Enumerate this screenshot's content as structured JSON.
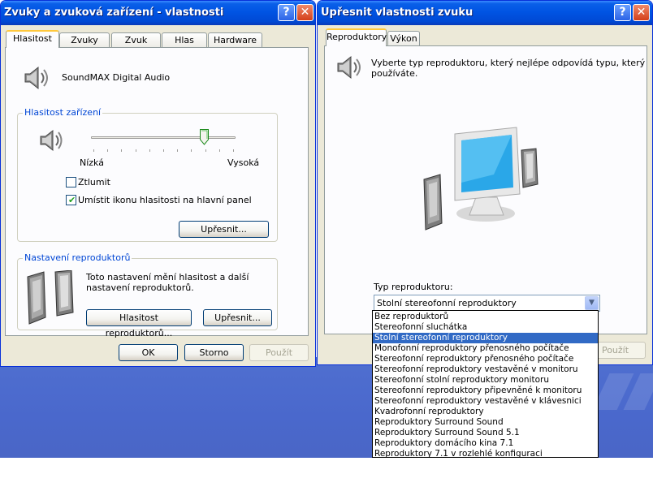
{
  "window1": {
    "title": "Zvuky a zvuková zařízení - vlastnosti",
    "tabs": [
      "Hlasitost",
      "Zvuky",
      "Zvuk",
      "Hlas",
      "Hardware"
    ],
    "device_name": "SoundMAX Digital Audio",
    "volume_group": {
      "legend": "Hlasitost zařízení",
      "low_label": "Nízká",
      "high_label": "Vysoká",
      "level_percent": 80,
      "mute_label": "Ztlumit",
      "mute_checked": false,
      "tray_label": "Umístit ikonu hlasitosti na hlavní panel",
      "tray_checked": true,
      "advanced_button": "Upřesnit..."
    },
    "speaker_group": {
      "legend": "Nastavení reproduktorů",
      "description": [
        "Toto nastavení mění hlasitost a další",
        "nastavení reproduktorů."
      ],
      "volume_button": "Hlasitost reproduktorů...",
      "advanced_button": "Upřesnit..."
    },
    "buttons": {
      "ok": "OK",
      "cancel": "Storno",
      "apply": "Použít"
    }
  },
  "window2": {
    "title": "Upřesnit vlastnosti zvuku",
    "tabs": [
      "Reproduktory",
      "Výkon"
    ],
    "instruction": [
      "Vyberte typ reproduktoru, který nejlépe odpovídá typu, který",
      "používáte."
    ],
    "type_label": "Typ reproduktoru:",
    "selected_value": "Stolní stereofonní reproduktory",
    "apply_button": "Použít",
    "options": [
      "Bez reproduktorů",
      "Stereofonní sluchátka",
      "Stolní stereofonní reproduktory",
      "Monofonní reproduktory přenosného počítače",
      "Stereofonní reproduktory přenosného počítače",
      "Stereofonní reproduktory vestavěné v monitoru",
      "Stereofonní stolní reproduktory monitoru",
      "Stereofonní reproduktory připevněné k monitoru",
      "Stereofonní reproduktory vestavěné v klávesnici",
      "Kvadrofonní reproduktory",
      "Reproduktory Surround Sound",
      "Reproduktory Surround Sound 5.1",
      "Reproduktory domácího kina 7.1",
      "Reproduktory 7.1 v rozlehlé konfiguraci"
    ],
    "selected_index": 2
  },
  "colors": {
    "accent": "#0054e3",
    "selection": "#316ac5",
    "group_legend": "#0046d5"
  }
}
